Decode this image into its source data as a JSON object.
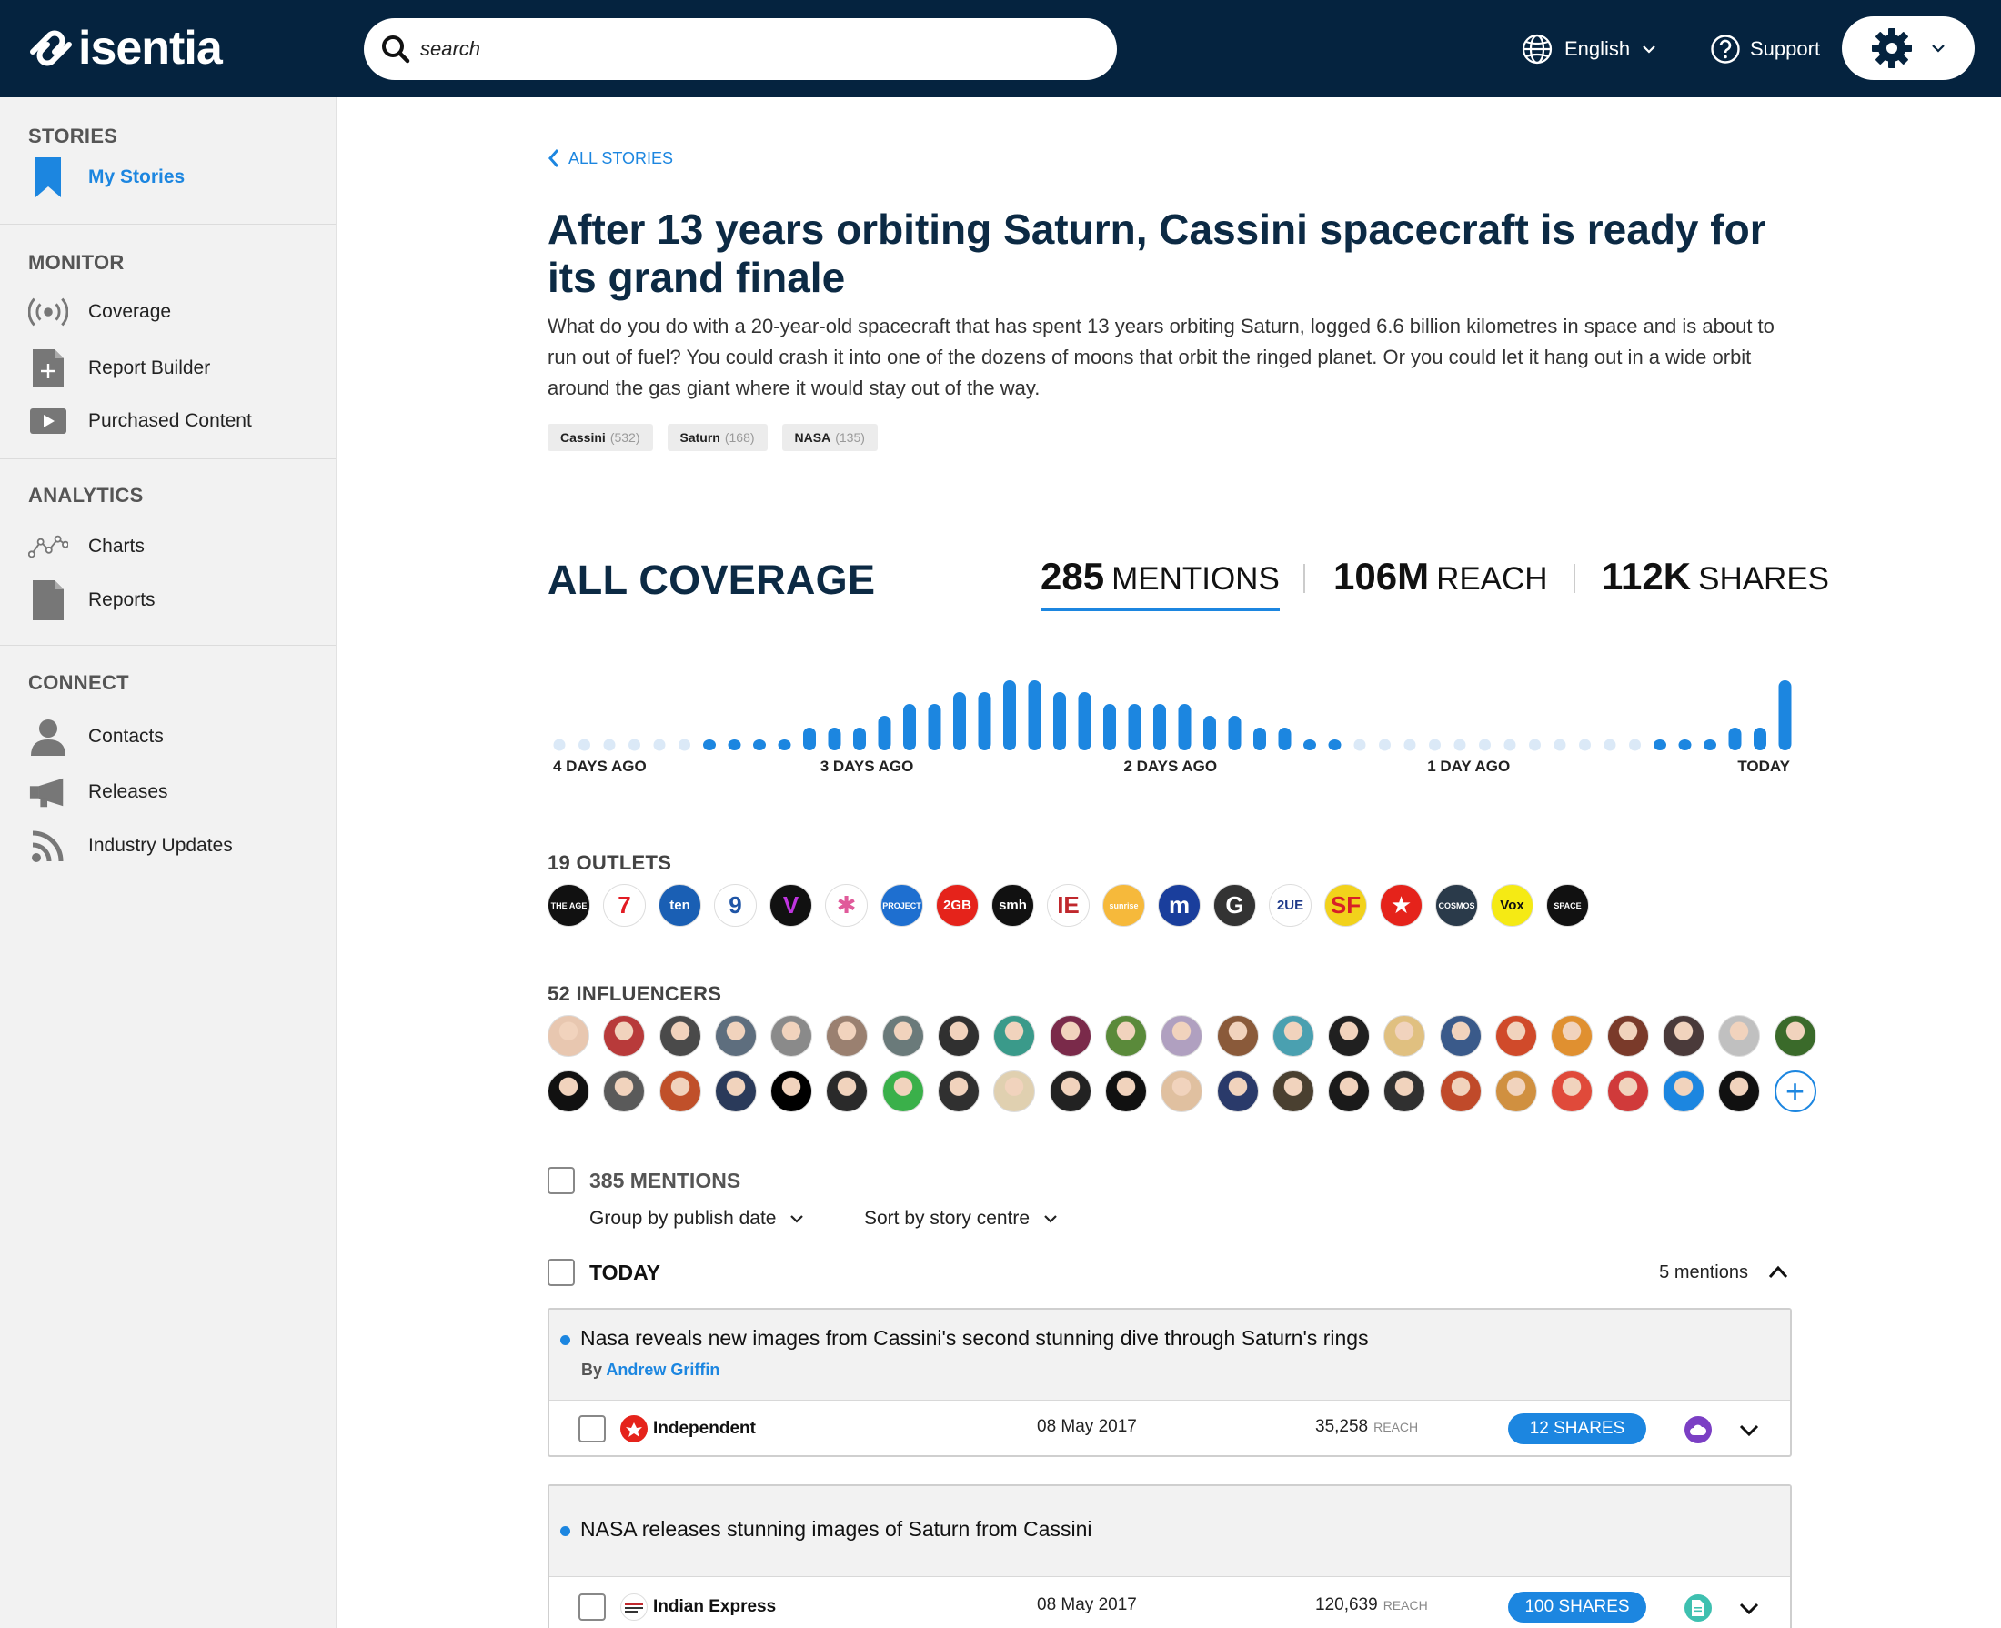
{
  "brand": {
    "name": "isentia"
  },
  "search": {
    "placeholder": "search"
  },
  "header": {
    "language": "English",
    "support": "Support"
  },
  "colors": {
    "navy": "#05233f",
    "accent": "#1c86e0",
    "sidebar_bg": "#f2f2f2"
  },
  "sidebar": {
    "sections": [
      {
        "title": "STORIES",
        "items": [
          {
            "label": "My Stories",
            "icon": "bookmark-icon",
            "active": true
          }
        ]
      },
      {
        "title": "MONITOR",
        "items": [
          {
            "label": "Coverage",
            "icon": "broadcast-icon"
          },
          {
            "label": "Report Builder",
            "icon": "add-document-icon"
          },
          {
            "label": "Purchased Content",
            "icon": "video-play-icon"
          }
        ]
      },
      {
        "title": "ANALYTICS",
        "items": [
          {
            "label": "Charts",
            "icon": "line-chart-icon"
          },
          {
            "label": "Reports",
            "icon": "document-icon"
          }
        ]
      },
      {
        "title": "CONNECT",
        "items": [
          {
            "label": "Contacts",
            "icon": "person-icon"
          },
          {
            "label": "Releases",
            "icon": "megaphone-icon"
          },
          {
            "label": "Industry Updates",
            "icon": "rss-icon"
          }
        ]
      }
    ]
  },
  "story": {
    "back_label": "ALL STORIES",
    "title": "After 13 years orbiting Saturn, Cassini spacecraft is ready for its grand finale",
    "summary": "What do you do with a 20-year-old spacecraft that has spent 13 years orbiting Saturn, logged 6.6 billion kilometres in space and is about to run out of fuel? You could crash it into one of the dozens of moons that orbit the ringed planet. Or you could let it hang out in a wide orbit around the gas giant where it would stay out of the way.",
    "tags": [
      {
        "name": "Cassini",
        "count": "(532)"
      },
      {
        "name": "Saturn",
        "count": "(168)"
      },
      {
        "name": "NASA",
        "count": "(135)"
      }
    ]
  },
  "coverage": {
    "title": "ALL COVERAGE",
    "metrics": [
      {
        "value": "285",
        "label": "MENTIONS",
        "active": true
      },
      {
        "value": "106M",
        "label": "REACH"
      },
      {
        "value": "112K",
        "label": "SHARES"
      }
    ],
    "timeline": {
      "labels": [
        "4 DAYS AGO",
        "3 DAYS AGO",
        "2 DAYS AGO",
        "1 DAY AGO",
        "TODAY"
      ],
      "levels": [
        0,
        0,
        0,
        0,
        0,
        0,
        1,
        1,
        1,
        1,
        2,
        2,
        2,
        3,
        4,
        4,
        5,
        5,
        6,
        6,
        5,
        5,
        4,
        4,
        4,
        4,
        3,
        3,
        2,
        2,
        1,
        1,
        0,
        0,
        0,
        0,
        0,
        0,
        0,
        0,
        0,
        0,
        0,
        0,
        1,
        1,
        1,
        2,
        2,
        6,
        5
      ],
      "empty_color": "#dbe9f7",
      "bar_color": "#1c86e0"
    }
  },
  "outlets": {
    "title": "19 OUTLETS",
    "items": [
      {
        "name": "the-age",
        "text": "THE AGE",
        "bg": "#111111",
        "fg": "#ffffff"
      },
      {
        "name": "channel-7",
        "text": "7",
        "bg": "#ffffff",
        "fg": "#e21b23"
      },
      {
        "name": "ten",
        "text": "ten",
        "bg": "#1a5fb4",
        "fg": "#ffffff"
      },
      {
        "name": "channel-9",
        "text": "9",
        "bg": "#ffffff",
        "fg": "#1f55a6"
      },
      {
        "name": "vice",
        "text": "V",
        "bg": "#111111",
        "fg": "#c035e0"
      },
      {
        "name": "sbs",
        "text": "✱",
        "bg": "#ffffff",
        "fg": "#e05a9a"
      },
      {
        "name": "the-project",
        "text": "PROJECT",
        "bg": "#1e6fd0",
        "fg": "#ffffff"
      },
      {
        "name": "2gb",
        "text": "2GB",
        "bg": "#e5231b",
        "fg": "#ffffff"
      },
      {
        "name": "smh",
        "text": "smh",
        "bg": "#111111",
        "fg": "#ffffff"
      },
      {
        "name": "indian-express-outlet",
        "text": "IE",
        "bg": "#ffffff",
        "fg": "#c0282d"
      },
      {
        "name": "sunrise",
        "text": "sunrise",
        "bg": "#f6b93b",
        "fg": "#ffffff"
      },
      {
        "name": "mashable",
        "text": "m",
        "bg": "#1a3e9c",
        "fg": "#ffffff"
      },
      {
        "name": "guardian",
        "text": "G",
        "bg": "#333333",
        "fg": "#ffffff"
      },
      {
        "name": "2ue",
        "text": "2UE",
        "bg": "#ffffff",
        "fg": "#1f3a8a"
      },
      {
        "name": "sfgate",
        "text": "SF",
        "bg": "#f2d21b",
        "fg": "#d72027"
      },
      {
        "name": "independent-outlet",
        "text": "★",
        "bg": "#e5231b",
        "fg": "#ffffff"
      },
      {
        "name": "cosmos",
        "text": "COSMOS",
        "bg": "#2a3a4a",
        "fg": "#ffffff"
      },
      {
        "name": "vox",
        "text": "Vox",
        "bg": "#f5ea14",
        "fg": "#111111"
      },
      {
        "name": "space",
        "text": "SPACE",
        "bg": "#111111",
        "fg": "#ffffff"
      }
    ]
  },
  "influencers": {
    "title": "52 INFLUENCERS",
    "row1": [
      "#e8c7b0",
      "#b83a3a",
      "#4a4a4a",
      "#5e6e7e",
      "#8a8a8a",
      "#9a8070",
      "#6a7a7a",
      "#303030",
      "#3a9a8a",
      "#7a2a4a",
      "#5a8a3a",
      "#b0a0c0",
      "#8a5a3a",
      "#4aa0b0",
      "#202020",
      "#e0c080",
      "#3a5a8a",
      "#d04a2a",
      "#e09030",
      "#7a3a2a",
      "#4a3a3a",
      "#c0c0c0",
      "#3a6a2a"
    ],
    "row2": [
      "#111111",
      "#5a5a5a",
      "#c0502a",
      "#2a3a5a",
      "#000000",
      "#2a2a2a",
      "#3ab04a",
      "#303030",
      "#e0d0b0",
      "#222222",
      "#111111",
      "#e0c0a0",
      "#2a3a6a",
      "#4a4030",
      "#1a1a1a",
      "#303030",
      "#c04a2a",
      "#d09040",
      "#e04a3a",
      "#d03a3a",
      "#1c86e0",
      "#111111"
    ]
  },
  "mentions": {
    "header": "385 MENTIONS",
    "group_by": "Group by publish date",
    "sort_by": "Sort by story centre"
  },
  "groups": [
    {
      "label": "TODAY",
      "count": "5 mentions",
      "items": [
        {
          "title": "Nasa reveals new images from Cassini's second stunning dive through Saturn's rings",
          "by_prefix": "By ",
          "author": "Andrew Griffin",
          "outlet": "Independent",
          "date": "08 May 2017",
          "reach": "35,258",
          "reach_label": "REACH",
          "shares": "12 SHARES",
          "type_icon": "cloud-icon"
        },
        {
          "title": "NASA releases stunning images of Saturn from Cassini",
          "by_prefix": "",
          "author": "",
          "outlet": "Indian Express",
          "date": "08 May 2017",
          "reach": "120,639",
          "reach_label": "REACH",
          "shares": "100 SHARES",
          "type_icon": "article-icon"
        }
      ]
    }
  ]
}
